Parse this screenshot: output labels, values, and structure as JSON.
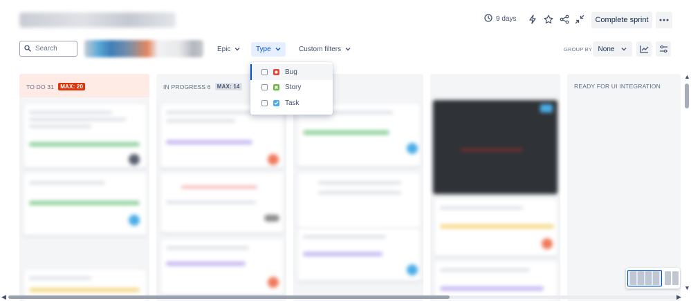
{
  "header": {
    "sprint_days": "9 days",
    "complete_sprint_label": "Complete sprint",
    "icons": [
      "clock-icon",
      "lightning-icon",
      "star-icon",
      "share-icon",
      "collapse-icon",
      "more-icon"
    ]
  },
  "filters": {
    "search_placeholder": "Search",
    "epic_label": "Epic",
    "type_label": "Type",
    "custom_filters_label": "Custom filters",
    "group_by_label": "GROUP BY",
    "group_by_value": "None"
  },
  "type_dropdown": {
    "items": [
      {
        "label": "Bug",
        "checked": false,
        "color": "#e5493a"
      },
      {
        "label": "Story",
        "checked": false,
        "color": "#63ba3c"
      },
      {
        "label": "Task",
        "checked": false,
        "color": "#4bade8"
      }
    ]
  },
  "columns": [
    {
      "name": "TO DO 31",
      "limit": "MAX: 20"
    },
    {
      "name": "IN PROGRESS 6",
      "limit": "MAX: 14"
    },
    {
      "name": "READY FOR UI INTEGRATION",
      "limit": ""
    }
  ],
  "colors": {
    "accent": "#0052cc",
    "over_limit": "#de350b",
    "todo_bg": "#ffebe6"
  }
}
